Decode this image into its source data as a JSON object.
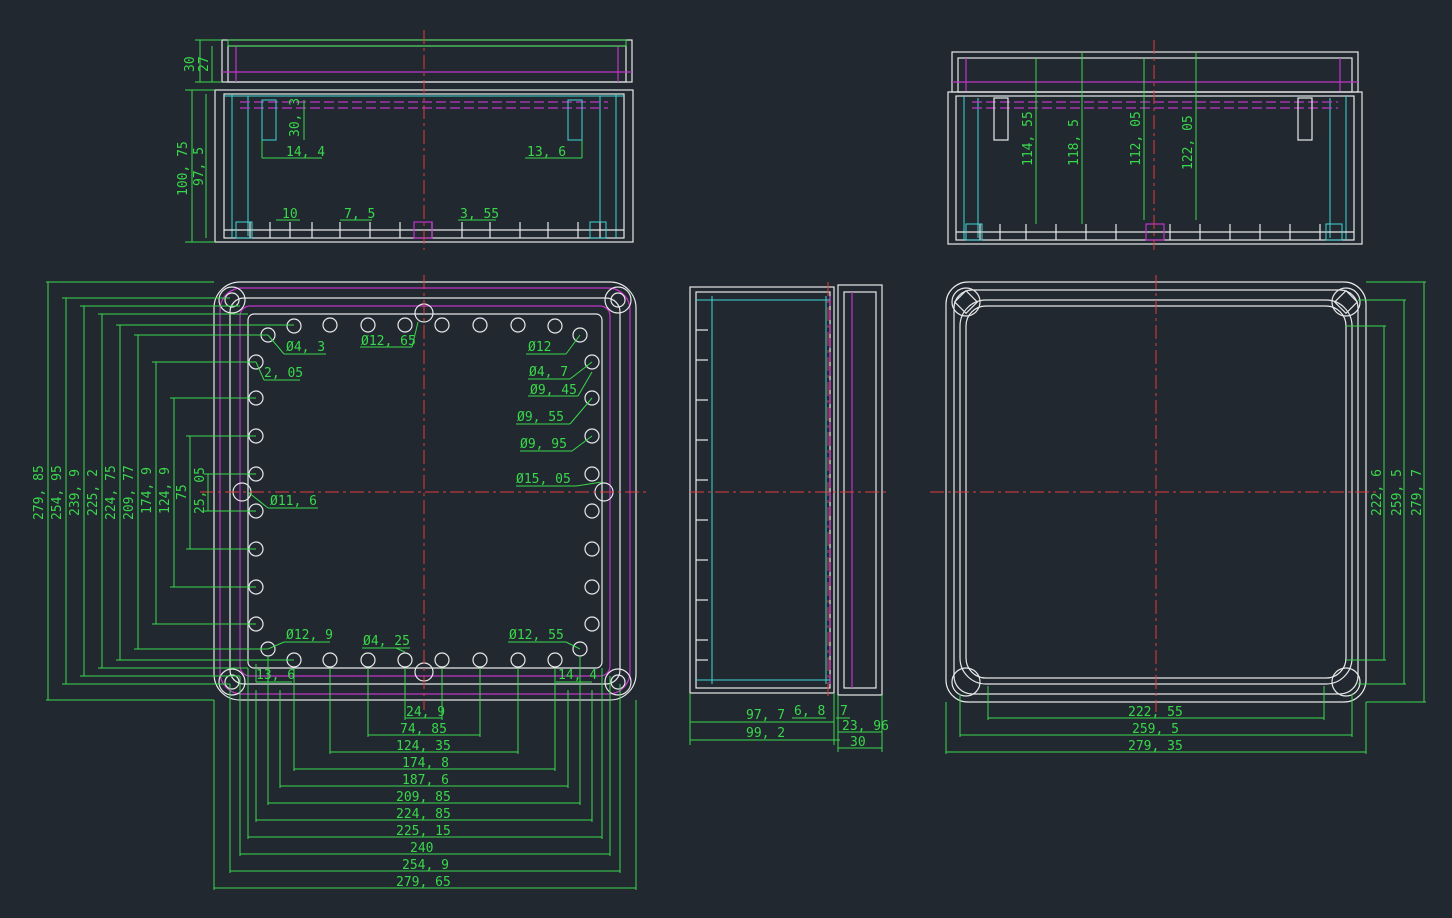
{
  "colors": {
    "background": "#212830",
    "dimension": "#39d84a",
    "outline": "#e8e8e8",
    "hidden": "#c034c8",
    "inner": "#3fd6d6",
    "center": "#e03c3c"
  },
  "dims": {
    "top_front": [
      "30",
      "27",
      "100, 75",
      "97, 5",
      "30, 3",
      "14, 4",
      "13, 6",
      "10",
      "7, 5",
      "3, 55"
    ],
    "top_side": [
      "114, 55",
      "118, 5",
      "112, 05",
      "122, 05"
    ],
    "plan_left": [
      "279, 85",
      "254, 95",
      "239, 9",
      "225, 2",
      "224, 75",
      "209, 77",
      "174, 9",
      "124, 9",
      "75",
      "25, 05"
    ],
    "plan_bottom": [
      "24, 9",
      "74, 85",
      "124, 35",
      "174, 8",
      "187, 6",
      "209, 85",
      "224, 85",
      "225, 15",
      "240",
      "254, 9",
      "279, 65"
    ],
    "plan_notes": [
      "Ø4, 3",
      "Ø12, 65",
      "Ø12",
      "2, 05",
      "Ø4, 7",
      "Ø9, 45",
      "Ø9, 55",
      "Ø9, 95",
      "Ø15, 05",
      "Ø11, 6",
      "Ø12, 9",
      "Ø4, 25",
      "Ø12, 55",
      "13, 6",
      "14, 4"
    ],
    "section": [
      "97, 7",
      "6, 8",
      "7",
      "99, 2",
      "23, 96",
      "30"
    ],
    "lid_bottom": [
      "222, 55",
      "259, 5",
      "279, 35"
    ],
    "lid_right": [
      "222, 6",
      "259, 5",
      "279, 7"
    ]
  }
}
